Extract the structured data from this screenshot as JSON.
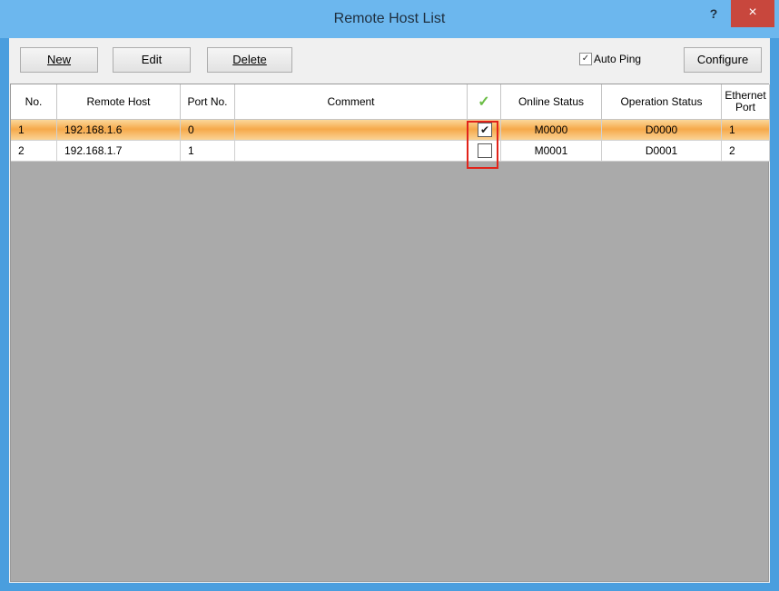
{
  "window": {
    "title": "Remote Host List",
    "help_label": "?",
    "close_label": "×"
  },
  "toolbar": {
    "new_label": "New",
    "edit_label": "Edit",
    "delete_label": "Delete",
    "auto_ping_label": "Auto Ping",
    "auto_ping_checked": true,
    "configure_label": "Configure"
  },
  "table": {
    "columns": [
      "No.",
      "Remote Host",
      "Port No.",
      "Comment",
      "",
      "Online Status",
      "Operation Status",
      "Ethernet Port"
    ],
    "ethernet_line1": "Ethernet",
    "ethernet_line2": "Port",
    "rows": [
      {
        "no": "1",
        "host": "192.168.1.6",
        "port": "0",
        "comment": "",
        "checked": true,
        "online": "M0000",
        "operation": "D0000",
        "ethernet": "1",
        "selected": true
      },
      {
        "no": "2",
        "host": "192.168.1.7",
        "port": "1",
        "comment": "",
        "checked": false,
        "online": "M0001",
        "operation": "D0001",
        "ethernet": "2",
        "selected": false
      }
    ]
  },
  "colors": {
    "accent": "#6cb7ee",
    "close": "#c8473d",
    "selection": "#f6a94a",
    "highlight_border": "#e2231a"
  }
}
